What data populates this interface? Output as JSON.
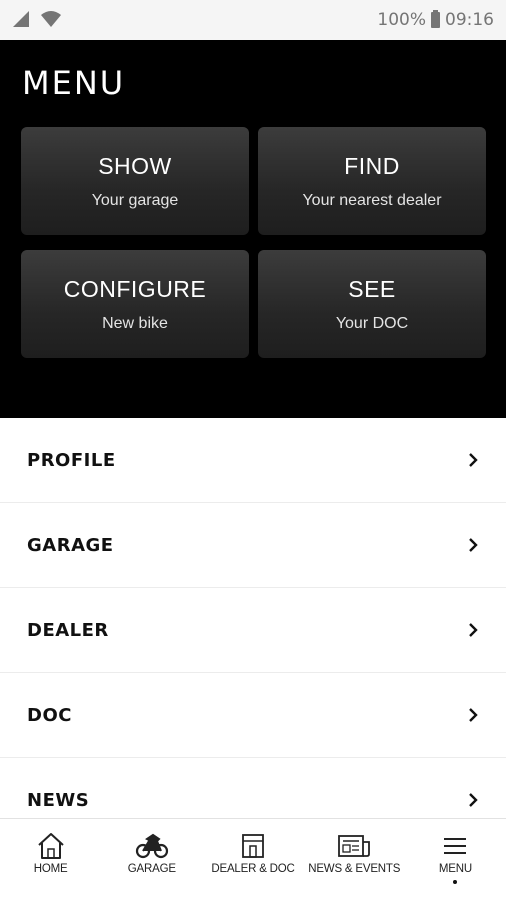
{
  "status_bar": {
    "battery": "100%",
    "time": "09:16"
  },
  "hero": {
    "title": "MENU",
    "tiles": [
      {
        "title": "SHOW",
        "subtitle": "Your garage"
      },
      {
        "title": "FIND",
        "subtitle": "Your nearest dealer"
      },
      {
        "title": "CONFIGURE",
        "subtitle": "New bike"
      },
      {
        "title": "SEE",
        "subtitle": "Your DOC"
      }
    ]
  },
  "menu": {
    "items": [
      {
        "label": "PROFILE"
      },
      {
        "label": "GARAGE"
      },
      {
        "label": "DEALER"
      },
      {
        "label": "DOC"
      },
      {
        "label": "NEWS"
      }
    ]
  },
  "bottom_nav": {
    "items": [
      {
        "label": "HOME",
        "icon": "home-icon"
      },
      {
        "label": "GARAGE",
        "icon": "motorbike-icon"
      },
      {
        "label": "DEALER & DOC",
        "icon": "dealer-icon"
      },
      {
        "label": "NEWS & EVENTS",
        "icon": "newspaper-icon"
      },
      {
        "label": "MENU",
        "icon": "hamburger-icon",
        "active": true
      }
    ]
  },
  "colors": {
    "hero_background": "#000000",
    "tile_background": "#2e2e2e",
    "status_bar": "#f5f5f5"
  }
}
